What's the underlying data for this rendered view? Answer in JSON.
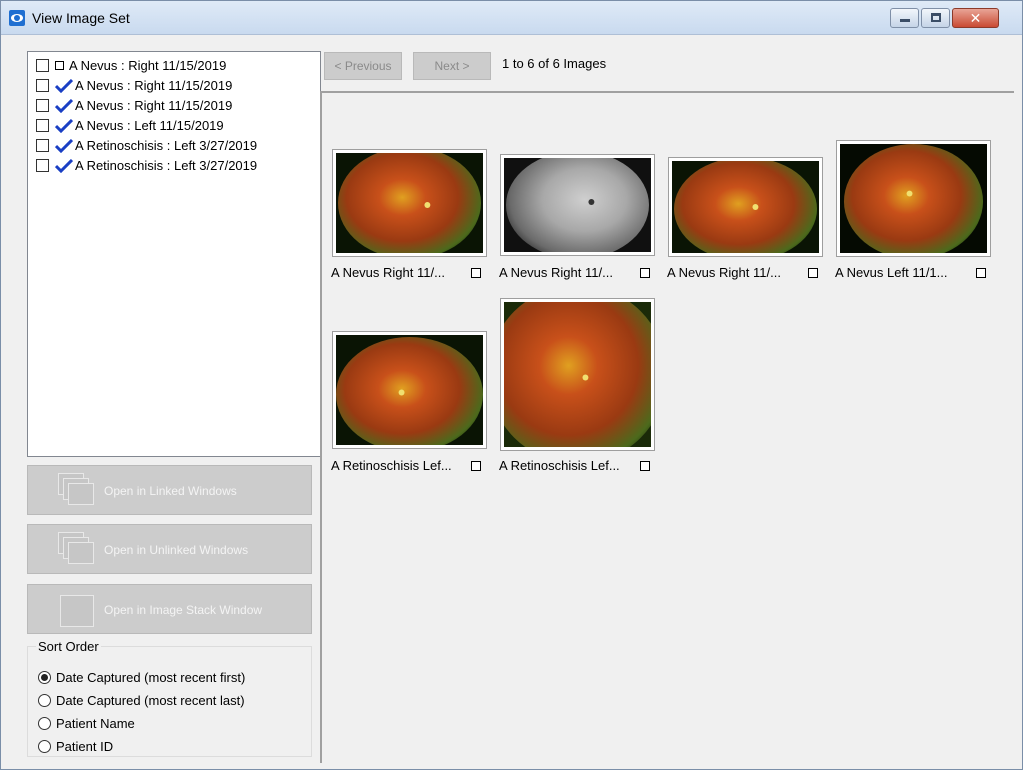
{
  "window": {
    "title": "View Image Set"
  },
  "series_list": [
    {
      "label": "A Nevus : Right 11/15/2019",
      "marker": "square",
      "checked": false
    },
    {
      "label": "A Nevus : Right 11/15/2019",
      "marker": "check-icon",
      "checked": false
    },
    {
      "label": "A Nevus : Right 11/15/2019",
      "marker": "check-icon",
      "checked": false
    },
    {
      "label": "A Nevus : Left 11/15/2019",
      "marker": "check-icon",
      "checked": false
    },
    {
      "label": "A Retinoschisis : Left 3/27/2019",
      "marker": "check-icon",
      "checked": false
    },
    {
      "label": "A Retinoschisis : Left 3/27/2019",
      "marker": "check-icon",
      "checked": false
    }
  ],
  "actions": {
    "open_linked": "Open in Linked Windows",
    "open_unlinked": "Open in Unlinked Windows",
    "open_stack": "Open in Image Stack Window"
  },
  "sort_order": {
    "legend": "Sort Order",
    "options": [
      {
        "label": "Date Captured (most recent first)",
        "selected": true
      },
      {
        "label": "Date Captured (most recent last)",
        "selected": false
      },
      {
        "label": "Patient Name",
        "selected": false
      },
      {
        "label": "Patient ID",
        "selected": false
      }
    ]
  },
  "navigation": {
    "previous_label": "< Previous",
    "next_label": "Next >",
    "count_text": "1 to 6 of 6 Images"
  },
  "thumbnails": [
    {
      "label": "A Nevus Right 11/...",
      "kind": "color",
      "selected": false
    },
    {
      "label": "A Nevus Right 11/...",
      "kind": "grayscale",
      "selected": false
    },
    {
      "label": "A Nevus Right 11/...",
      "kind": "color",
      "selected": false
    },
    {
      "label": "A Nevus Left 11/1...",
      "kind": "color",
      "selected": false
    },
    {
      "label": "A Retinoschisis Lef...",
      "kind": "color",
      "selected": false
    },
    {
      "label": "A Retinoschisis Lef...",
      "kind": "color",
      "selected": false
    }
  ],
  "colors": {
    "check_blue": "#1a3fc4",
    "disabled_button": "#cccccc",
    "fundus_red": "#b83a14",
    "fundus_green": "#5a7a1e"
  }
}
